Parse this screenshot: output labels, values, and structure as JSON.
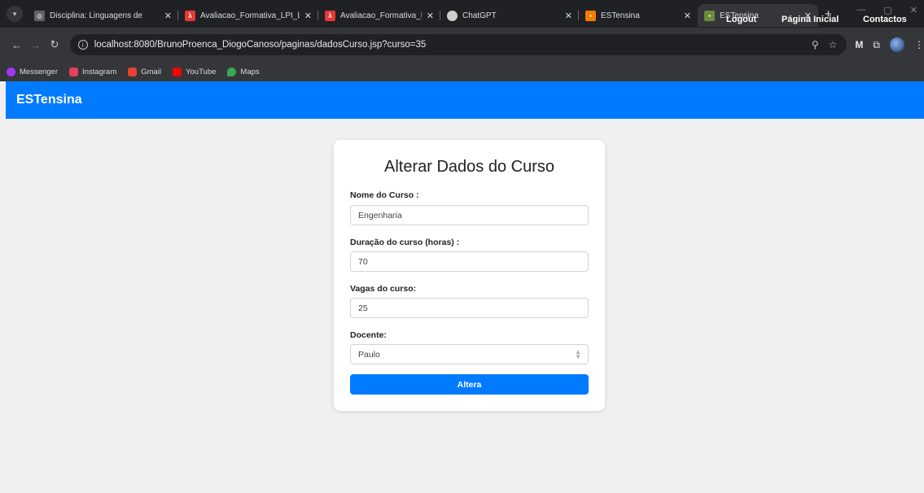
{
  "browser": {
    "tabs": [
      {
        "title": "Disciplina: Linguagens de",
        "favicon": "globe-icon",
        "color": "#9aa0a6"
      },
      {
        "title": "Avaliacao_Formativa_LPI_L",
        "favicon": "pdf-icon",
        "color": "#e53935"
      },
      {
        "title": "Avaliacao_Formativa_LPI_L",
        "favicon": "pdf-icon",
        "color": "#e53935"
      },
      {
        "title": "ChatGPT",
        "favicon": "chatgpt-icon",
        "color": "#cfcfcf"
      },
      {
        "title": "ESTensina",
        "favicon": "app-icon",
        "color": "#f57c00"
      },
      {
        "title": "ESTensina",
        "favicon": "app-icon",
        "color": "#6d8a3a"
      }
    ],
    "url": "localhost:8080/BrunoProenca_DiogoCanoso/paginas/dadosCurso.jsp?curso=35",
    "bookmarks": [
      {
        "label": "Messenger",
        "icon": "messenger-icon",
        "color": "#a334fa"
      },
      {
        "label": "Instagram",
        "icon": "instagram-icon",
        "color": "#e4405f"
      },
      {
        "label": "Gmail",
        "icon": "gmail-icon",
        "color": "#ea4335"
      },
      {
        "label": "YouTube",
        "icon": "youtube-icon",
        "color": "#ff0000"
      },
      {
        "label": "Maps",
        "icon": "maps-icon",
        "color": "#34a853"
      }
    ]
  },
  "navbar": {
    "brand": "ESTensina",
    "links": {
      "logout": "Logout",
      "home": "Página Inicial",
      "contacts": "Contactos"
    },
    "color": "#007bff"
  },
  "form": {
    "title": "Alterar Dados do Curso",
    "name_label": "Nome do Curso :",
    "name_value": "Engenharia",
    "duration_label": "Duração do curso (horas) :",
    "duration_value": "70",
    "vacancies_label": "Vagas do curso:",
    "vacancies_value": "25",
    "teacher_label": "Docente:",
    "teacher_value": "Paulo",
    "submit_label": "Altera"
  }
}
